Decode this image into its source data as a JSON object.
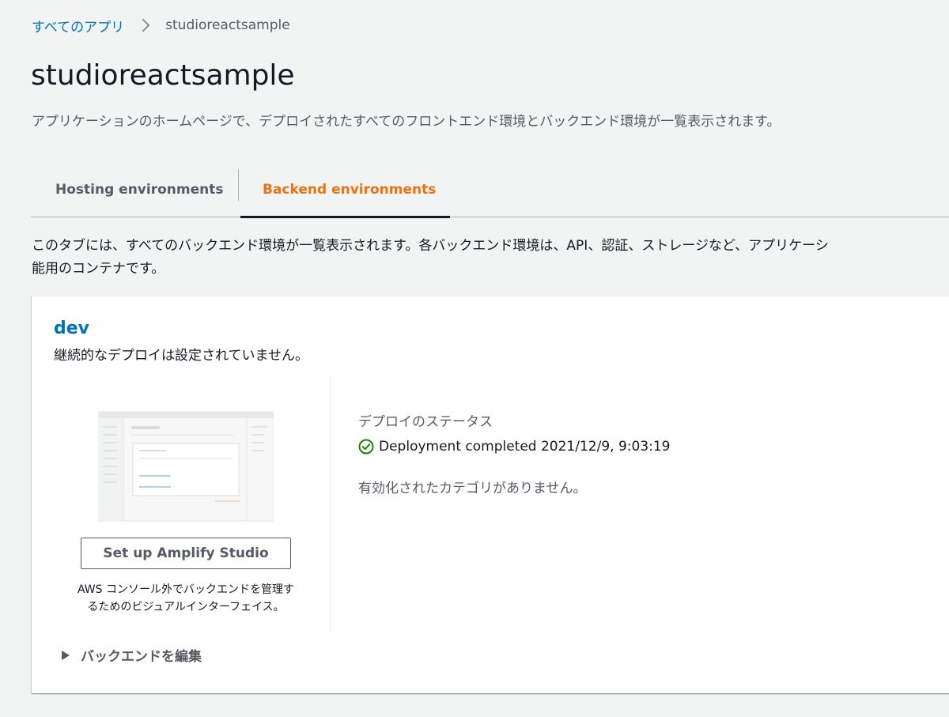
{
  "breadcrumb": {
    "parent": "すべてのアプリ",
    "current": "studioreactsample"
  },
  "page": {
    "title": "studioreactsample",
    "description": "アプリケーションのホームページで、デプロイされたすべてのフロントエンド環境とバックエンド環境が一覧表示されます。"
  },
  "tabs": {
    "hosting": "Hosting environments",
    "backend": "Backend environments",
    "active": "backend"
  },
  "tab_description": {
    "line1": "このタブには、すべてのバックエンド環境が一覧表示されます。各バックエンド環境は、API、認証、ストレージなど、アプリケーシ",
    "line2": "能用のコンテナです。"
  },
  "environment": {
    "name": "dev",
    "subtitle": "継続的なデプロイは設定されていません。",
    "setup_button": "Set up Amplify Studio",
    "setup_desc_line1": "AWS コンソール外でバックエンドを管理す",
    "setup_desc_line2": "るためのビジュアルインターフェイス。",
    "deploy_status_label": "デプロイのステータス",
    "deploy_status": "Deployment completed 2021/12/9, 9:03:19",
    "status_icon": "check-circle-icon",
    "no_categories": "有効化されたカテゴリがありません。",
    "edit_backend": "バックエンドを編集"
  },
  "colors": {
    "link": "#0073bb",
    "active_tab": "#ec7211",
    "success": "#1d8102"
  }
}
